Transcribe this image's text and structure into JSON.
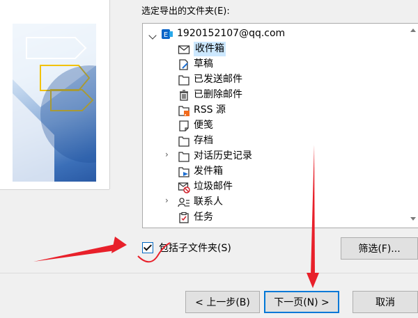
{
  "dialog": {
    "folder_prompt": "选定导出的文件夹(E):",
    "include_subfolders_label": "包括子文件夹(S)",
    "include_subfolders_checked": true
  },
  "tree": {
    "account": "1920152107@qq.com",
    "items": [
      {
        "label": "收件箱",
        "icon": "inbox-icon",
        "selected": true,
        "expandable": false
      },
      {
        "label": "草稿",
        "icon": "drafts-icon",
        "selected": false,
        "expandable": false
      },
      {
        "label": "已发送邮件",
        "icon": "folder-icon",
        "selected": false,
        "expandable": false
      },
      {
        "label": "已删除邮件",
        "icon": "trash-icon",
        "selected": false,
        "expandable": false
      },
      {
        "label": "RSS 源",
        "icon": "rss-icon",
        "selected": false,
        "expandable": false
      },
      {
        "label": "便笺",
        "icon": "note-icon",
        "selected": false,
        "expandable": false
      },
      {
        "label": "存档",
        "icon": "folder-icon",
        "selected": false,
        "expandable": false
      },
      {
        "label": "对话历史记录",
        "icon": "folder-icon",
        "selected": false,
        "expandable": true
      },
      {
        "label": "发件箱",
        "icon": "outbox-icon",
        "selected": false,
        "expandable": false
      },
      {
        "label": "垃圾邮件",
        "icon": "junk-icon",
        "selected": false,
        "expandable": false
      },
      {
        "label": "联系人",
        "icon": "contacts-icon",
        "selected": false,
        "expandable": true
      },
      {
        "label": "任务",
        "icon": "tasks-icon",
        "selected": false,
        "expandable": false
      }
    ]
  },
  "buttons": {
    "filter": "筛选(F)...",
    "back": "< 上一步(B)",
    "next": "下一页(N) >",
    "cancel": "取消"
  },
  "colors": {
    "annotation": "#e8202a",
    "selection": "#cce8ff",
    "default_button_border": "#0078d7"
  }
}
